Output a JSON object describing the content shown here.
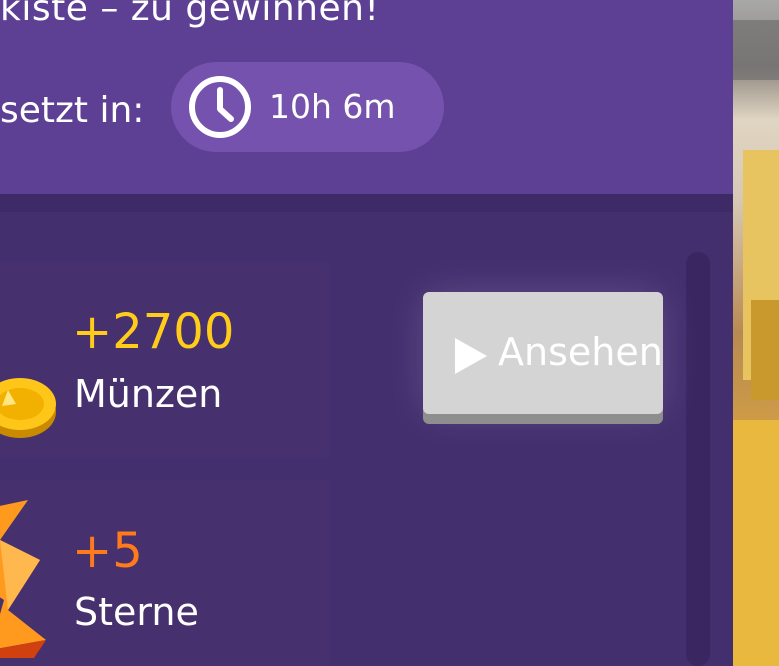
{
  "header": {
    "title": "kiste – zu gewinnen!",
    "reset_label": "setzt in:",
    "timer": "10h 6m",
    "timer_icon": "clock-icon"
  },
  "rewards": [
    {
      "value": "+2700",
      "label": "Münzen",
      "icon": "coin-icon",
      "color": "#ffcc1a"
    },
    {
      "value": "+5",
      "label": "Sterne",
      "icon": "star-icon",
      "color": "#ff7a1a"
    }
  ],
  "watch_button": {
    "label": "Ansehen",
    "icon": "play-icon"
  },
  "colors": {
    "header_bg": "#5d3f94",
    "body_bg": "#432e6e",
    "pill_bg": "#7552ad",
    "button_bg": "#d4d4d4"
  }
}
